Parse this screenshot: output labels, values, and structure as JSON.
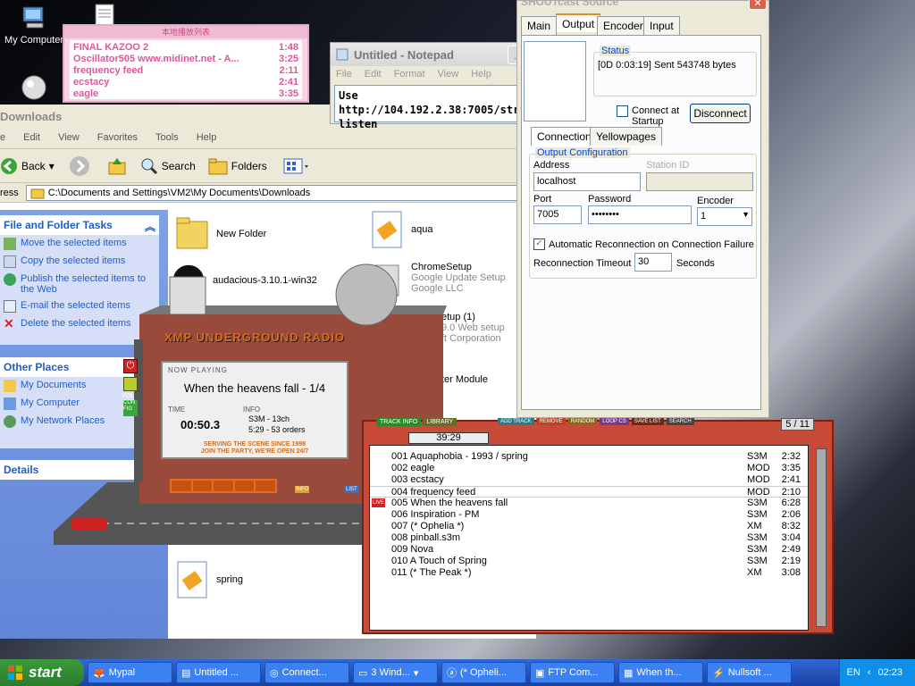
{
  "desktop": {
    "my_computer": "My Computer"
  },
  "pink_playlist": {
    "title": "本地播放列表",
    "items": [
      {
        "name": "FINAL KAZOO 2",
        "time": "1:48"
      },
      {
        "name": "Oscillator505 www.midinet.net - A...",
        "time": "3:25"
      },
      {
        "name": "frequency feed",
        "time": "2:11"
      },
      {
        "name": "ecstacy",
        "time": "2:41"
      },
      {
        "name": "eagle",
        "time": "3:35"
      }
    ]
  },
  "explorer": {
    "title": "Downloads",
    "menu": [
      "e",
      "Edit",
      "View",
      "Favorites",
      "Tools",
      "Help"
    ],
    "toolbar": {
      "back": "Back",
      "search": "Search",
      "folders": "Folders"
    },
    "address_label": "ress",
    "address": "C:\\Documents and Settings\\VM2\\My Documents\\Downloads",
    "file_tasks": {
      "title": "File and Folder Tasks",
      "items": [
        "Move the selected items",
        "Copy the selected items",
        "Publish the selected items to the Web",
        "E-mail the selected items",
        "Delete the selected items"
      ]
    },
    "other_places": {
      "title": "Other Places",
      "items": [
        "My Documents",
        "My Computer",
        "My Network Places"
      ]
    },
    "details": {
      "title": "Details"
    },
    "files": {
      "new_folder": "New Folder",
      "aqua": "aqua",
      "audacious": "audacious-3.10.1-win32",
      "chrome": "ChromeSetup",
      "chrome_sub1": "Google Update Setup",
      "chrome_sub2": "Google LLC",
      "setup": "etup (1)",
      "setup_sub1": "9.0 Web setup",
      "setup_sub2": "ft Corporation",
      "module": "ter Module",
      "spring": "spring"
    }
  },
  "notepad": {
    "title": "Untitled - Notepad",
    "menu": [
      "File",
      "Edit",
      "Format",
      "View",
      "Help"
    ],
    "text": "Use http://104.192.2.38:7005/stream to listen"
  },
  "shoutcast": {
    "title": "SHOUTcast Source",
    "tabs": [
      "Main",
      "Output",
      "Encoder",
      "Input"
    ],
    "status_label": "Status",
    "status": "[0D 0:03:19] Sent 543748 bytes",
    "connect_at_startup": "Connect at Startup",
    "disconnect": "Disconnect",
    "subtabs": [
      "Connection",
      "Yellowpages"
    ],
    "output_config": "Output Configuration",
    "address_label": "Address",
    "address": "localhost",
    "station_id_label": "Station ID",
    "port_label": "Port",
    "port": "7005",
    "password_label": "Password",
    "password": "••••••••",
    "encoder_label": "Encoder",
    "encoder": "1",
    "auto_reconnect": "Automatic Reconnection on Connection Failure",
    "timeout_label": "Reconnection Timeout",
    "timeout": "30",
    "seconds": "Seconds"
  },
  "xmplay": {
    "sign": "XMP UNDERGROUND RADIO",
    "now_playing_label": "NOW PLAYING",
    "now_playing": "When the heavens fall - 1/4",
    "time_label": "TIME",
    "info_label": "INFO",
    "time": "00:50.3",
    "info1": "S3M - 13ch",
    "info2": "5:29 - 53 orders",
    "slogan1": "SERVING THE SCENE SINCE 1998",
    "slogan2": "JOIN THE PARTY, WE'RE OPEN 24/7",
    "info_sign": "INFO",
    "list_sign": "LIST",
    "vol": "VOL",
    "config": "CON FIG"
  },
  "playlist": {
    "tabs": [
      "TRACK INFO",
      "LIBRARY"
    ],
    "buttons": [
      "ADD TRACK",
      "REMOVE",
      "RANDOM",
      "LOOP CS",
      "SAVE LIST",
      "SEARCH"
    ],
    "total_time": "39:29",
    "position": "5 / 11",
    "tracks": [
      {
        "title": "001 Aquaphobia  - 1993 / spring",
        "type": "S3M",
        "dur": "2:32"
      },
      {
        "title": "002 eagle",
        "type": "MOD",
        "dur": "3:35"
      },
      {
        "title": "003 ecstacy",
        "type": "MOD",
        "dur": "2:41"
      },
      {
        "title": "004 frequency feed",
        "type": "MOD",
        "dur": "2:10"
      },
      {
        "title": "005 When the heavens fall",
        "type": "S3M",
        "dur": "6:28"
      },
      {
        "title": "006 Inspiration - PM",
        "type": "S3M",
        "dur": "2:06"
      },
      {
        "title": "007 (* Ophelia *)",
        "type": "XM",
        "dur": "8:32"
      },
      {
        "title": "008 pinball.s3m",
        "type": "S3M",
        "dur": "3:04"
      },
      {
        "title": "009 Nova",
        "type": "S3M",
        "dur": "2:49"
      },
      {
        "title": "010 A Touch of Spring",
        "type": "S3M",
        "dur": "2:19"
      },
      {
        "title": "011 (* The Peak *)",
        "type": "XM",
        "dur": "3:08"
      }
    ],
    "live": "LIVE"
  },
  "taskbar": {
    "start": "start",
    "buttons": [
      "Mypal",
      "Untitled ...",
      "Connect...",
      "3 Wind...",
      "(* Opheli...",
      "FTP Com...",
      "When th...",
      "Nullsoft ..."
    ],
    "lang": "EN",
    "clock": "02:23"
  }
}
